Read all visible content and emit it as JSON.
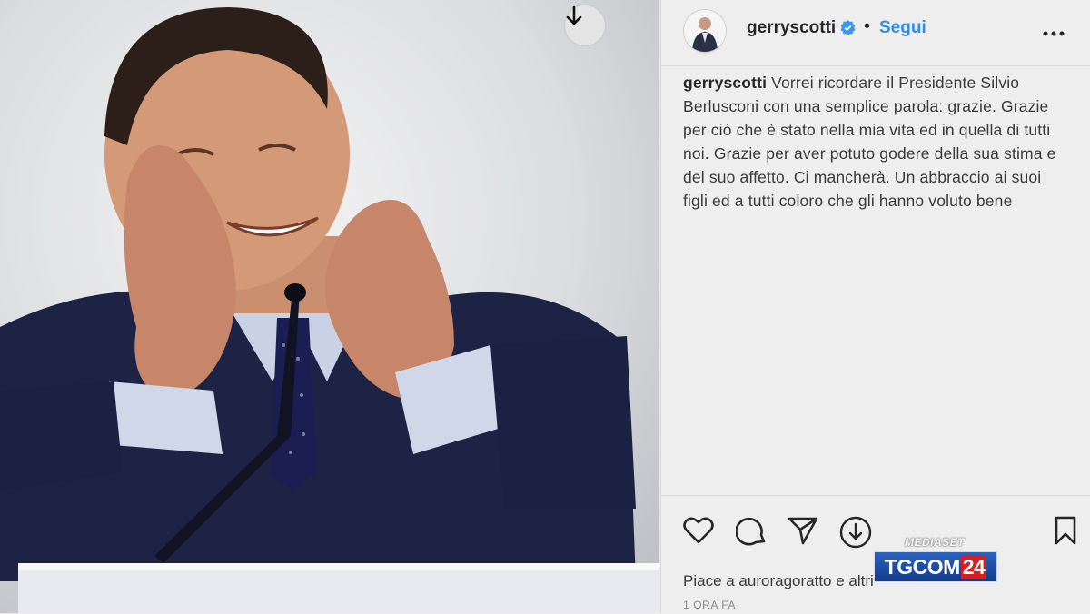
{
  "post": {
    "photo_alt_icon": "photo",
    "download_icon": "arrow-down-icon"
  },
  "header": {
    "username": "gerryscotti",
    "separator": "•",
    "follow_label": "Segui",
    "verified_icon": "verified-badge-icon",
    "more_icon": "ellipsis-icon"
  },
  "caption": {
    "username": "gerryscotti",
    "text": "Vorrei ricordare il Presidente Silvio Berlusconi con una semplice parola: grazie. Grazie per ciò che è stato nella mia vita ed in quella di tutti noi. Grazie per aver potuto godere della sua stima e del suo affetto. Ci mancherà. Un abbraccio ai suoi figli ed a tutti coloro che gli hanno voluto bene"
  },
  "actions": {
    "icons": [
      "heart-icon",
      "comment-icon",
      "send-icon",
      "download-icon",
      "bookmark-icon"
    ],
    "likes_text": "Piace a auroragoratto e altri",
    "time_text": "1 ORA FA"
  },
  "overlay": {
    "network": "MEDIASET",
    "channel_main": "TGCOM",
    "channel_num": "24"
  },
  "colors": {
    "follow": "#2f8fe6",
    "verified": "#3897f0",
    "brand_blue": "#1f4fa8",
    "brand_red": "#d81e1e"
  }
}
